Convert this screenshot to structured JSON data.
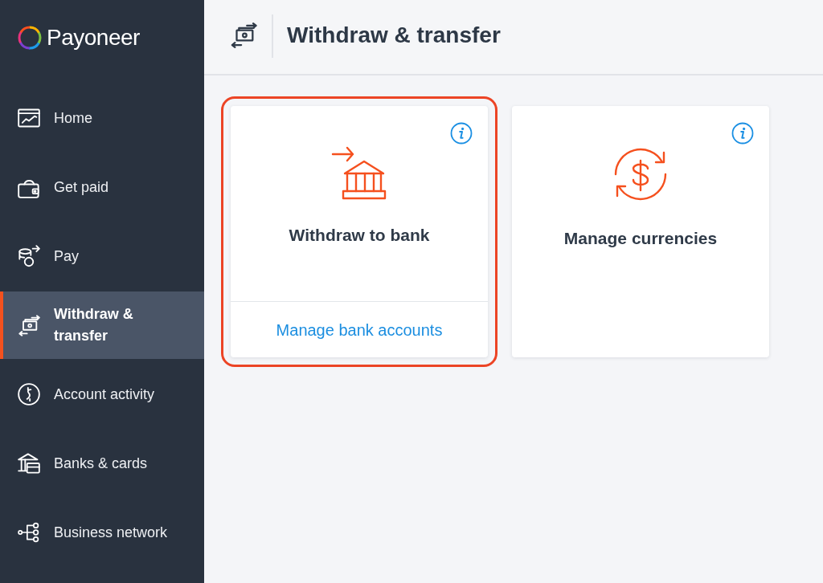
{
  "sidebar": {
    "logo": {
      "text": "Payoneer"
    },
    "items": [
      {
        "label": "Home",
        "selected": false
      },
      {
        "label": "Get paid",
        "selected": false
      },
      {
        "label": "Pay",
        "selected": false
      },
      {
        "label": "Withdraw & transfer",
        "selected": true
      },
      {
        "label": "Account activity",
        "selected": false
      },
      {
        "label": "Banks & cards",
        "selected": false
      },
      {
        "label": "Business network",
        "selected": false
      }
    ]
  },
  "header": {
    "title": "Withdraw & transfer"
  },
  "cards": [
    {
      "title": "Withdraw to bank",
      "highlighted": true,
      "link": "Manage bank accounts"
    },
    {
      "title": "Manage currencies",
      "highlighted": false
    }
  ]
}
